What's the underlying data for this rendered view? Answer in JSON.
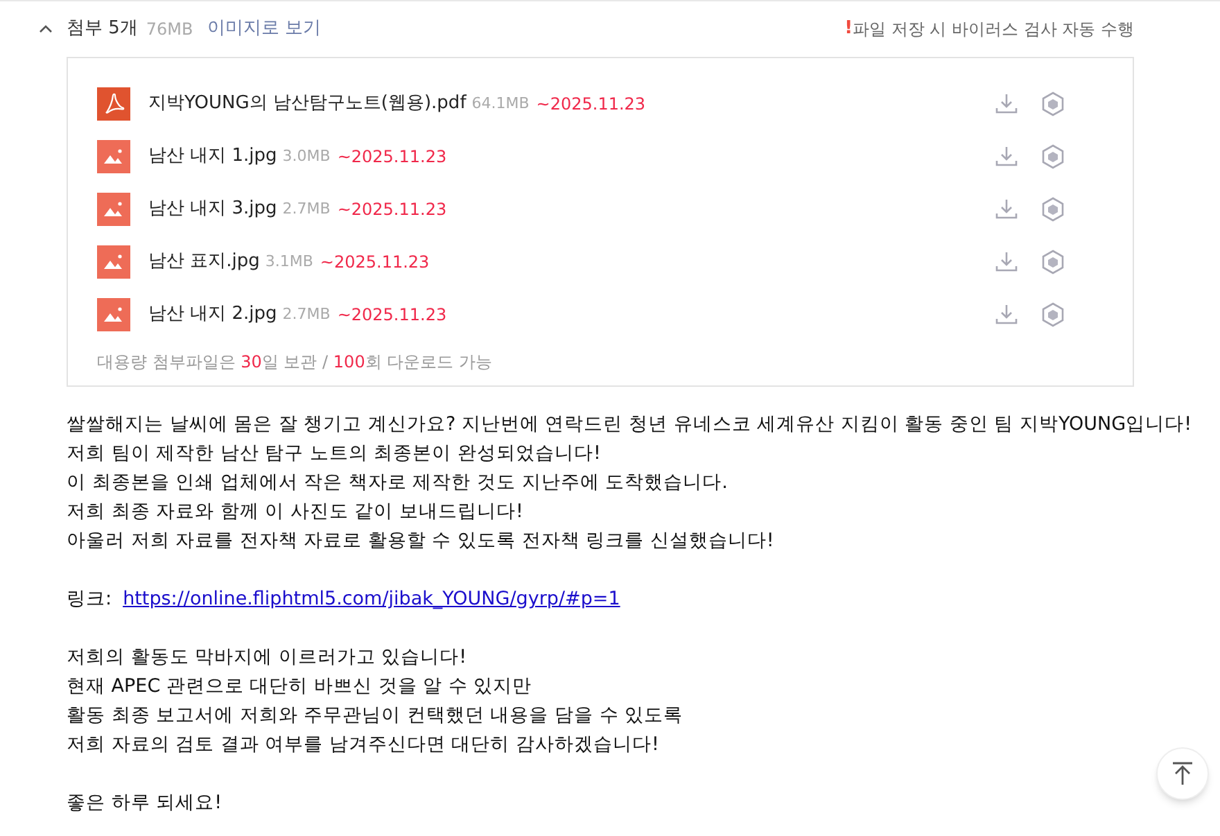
{
  "header": {
    "expanded": true,
    "title": "첨부 5개",
    "size": "76MB",
    "view_as_image": "이미지로 보기",
    "warning_mark": "!",
    "warning": "파일 저장 시 바이러스 검사 자동 수행"
  },
  "attachments": [
    {
      "kind": "pdf",
      "name": "지박YOUNG의 남산탐구노트(웹용).pdf",
      "size": "64.1MB",
      "expiry": "~2025.11.23"
    },
    {
      "kind": "image",
      "name": "남산 내지 1.jpg",
      "size": "3.0MB",
      "expiry": "~2025.11.23"
    },
    {
      "kind": "image",
      "name": "남산 내지 3.jpg",
      "size": "2.7MB",
      "expiry": "~2025.11.23"
    },
    {
      "kind": "image",
      "name": "남산 표지.jpg",
      "size": "3.1MB",
      "expiry": "~2025.11.23"
    },
    {
      "kind": "image",
      "name": "남산 내지 2.jpg",
      "size": "2.7MB",
      "expiry": "~2025.11.23"
    }
  ],
  "note": [
    {
      "text": "대용량 첨부파일은 ",
      "highlight": false
    },
    {
      "text": "30",
      "highlight": true
    },
    {
      "text": "일 보관 / ",
      "highlight": false
    },
    {
      "text": "100",
      "highlight": true
    },
    {
      "text": "회 다운로드 가능",
      "highlight": false
    }
  ],
  "body": [
    {
      "kind": "text",
      "lines": [
        "쌀쌀해지는 날씨에 몸은 잘 챙기고 계신가요? 지난번에 연락드린 청년 유네스코 세계유산 지킴이 활동 중인 팀 지박YOUNG입니다!",
        "저희 팀이 제작한 남산 탐구 노트의 최종본이 완성되었습니다!",
        "이 최종본을 인쇄 업체에서 작은 책자로 제작한 것도 지난주에 도착했습니다.",
        "저희 최종 자료와 함께 이 사진도 같이 보내드립니다!",
        "아울러 저희 자료를 전자책 자료로 활용할 수 있도록 전자책 링크를 신설했습니다!"
      ]
    },
    {
      "kind": "link",
      "label": "링크:",
      "url": "https://online.fliphtml5.com/jibak_YOUNG/gyrp/#p=1"
    },
    {
      "kind": "text",
      "lines": [
        "저희의 활동도 막바지에 이르러가고 있습니다!",
        "현재 APEC 관련으로 대단히 바쁘신 것을 알 수 있지만",
        "활동 최종 보고서에 저희와 주무관님이 컨택했던 내용을 담을 수 있도록",
        "저희 자료의 검토 결과 여부를 남겨주신다면 대단히 감사하겠습니다!"
      ]
    },
    {
      "kind": "text",
      "lines": [
        "좋은 하루 되세요!"
      ]
    }
  ]
}
